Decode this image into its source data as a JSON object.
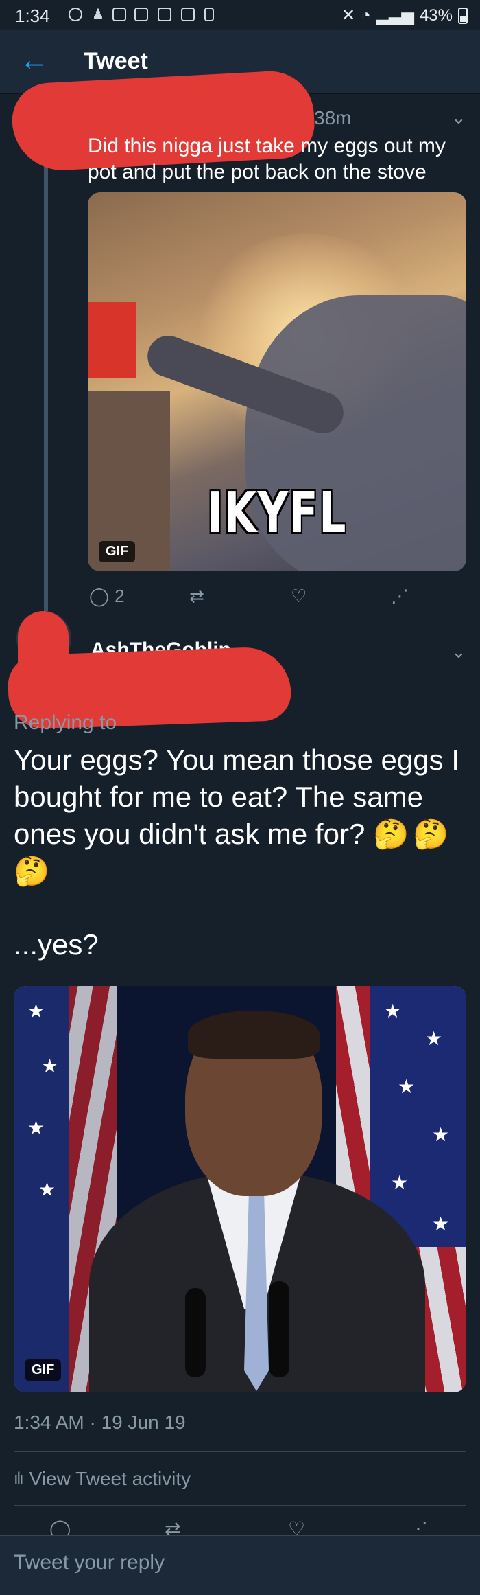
{
  "status_bar": {
    "time": "1:34",
    "battery": "43%"
  },
  "header": {
    "back_icon": "arrow-left-icon",
    "title": "Tweet"
  },
  "tweet_1": {
    "time_ago": "38m",
    "text": "Did this nigga just take my eggs out my pot and put the pot back on the stove",
    "media": {
      "badge": "GIF",
      "caption": "IKYFL"
    },
    "actions": {
      "reply_count": "2"
    }
  },
  "tweet_2": {
    "display_name": "AshTheGoblin",
    "replying_to": "Replying to",
    "text": "Your eggs? You mean those eggs I bought for me to eat? The same ones you didn't ask me for?",
    "emoji": "🤔🤔🤔",
    "text_2": "...yes?",
    "media": {
      "badge": "GIF"
    },
    "datetime": "1:34 AM · 19 Jun 19",
    "view_activity": "View Tweet activity"
  },
  "reply_box": {
    "placeholder": "Tweet your reply"
  },
  "colors": {
    "background": "#15202b",
    "header": "#1c2938",
    "accent": "#1da1f2",
    "muted": "#8899a6",
    "redaction": "#e23a36"
  }
}
